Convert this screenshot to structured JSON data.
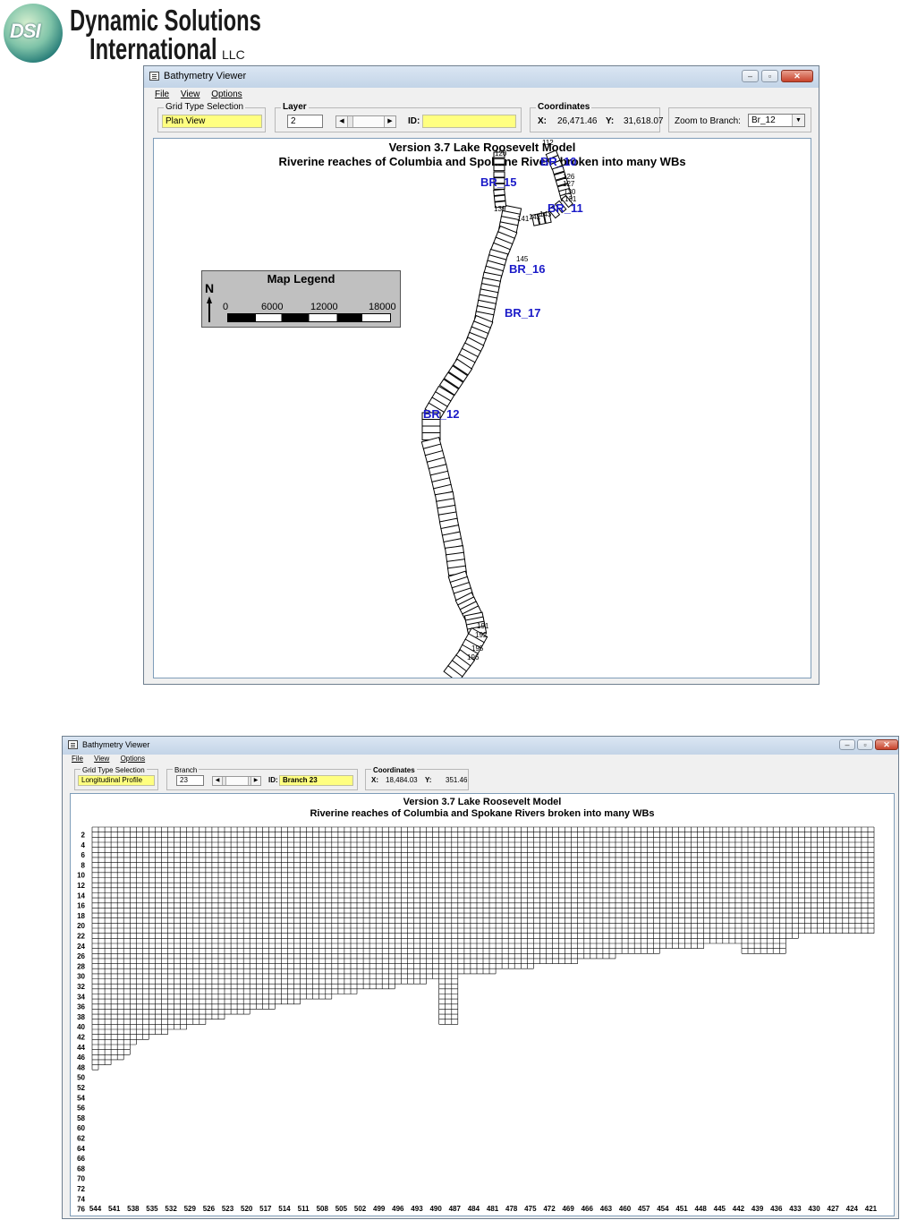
{
  "logo": {
    "mark": "DSI",
    "line1": "Dynamic Solutions",
    "line2": "International",
    "suffix": "LLC"
  },
  "window_top": {
    "title": "Bathymetry Viewer",
    "menu": [
      "File",
      "View",
      "Options"
    ],
    "grid_type": {
      "label": "Grid Type Selection",
      "value": "Plan View"
    },
    "layer": {
      "label": "Layer",
      "value": "2"
    },
    "id": {
      "label": "ID:",
      "value": ""
    },
    "coordinates": {
      "label": "Coordinates",
      "x_label": "X:",
      "x_value": "26,471.46",
      "y_label": "Y:",
      "y_value": "31,618.07"
    },
    "zoom": {
      "label": "Zoom to Branch:",
      "value": "Br_12"
    },
    "plot_title": "Version 3.7 Lake Roosevelt Model",
    "plot_subtitle": "Riverine reaches of Columbia and Spokane Rivers broken into many WBs",
    "legend": {
      "title": "Map Legend",
      "north": "N",
      "scale_labels": [
        "0",
        "6000",
        "12000",
        "18000"
      ]
    },
    "branch_labels": [
      "BR_15",
      "BR_10",
      "BR_11",
      "BR_16",
      "BR_17",
      "BR_12"
    ],
    "segment_labels": [
      "120",
      "112",
      "126",
      "127",
      "130",
      "131",
      "139",
      "141",
      "142",
      "143",
      "145",
      "191",
      "192",
      "195",
      "196"
    ]
  },
  "window_bottom": {
    "title": "Bathymetry Viewer",
    "menu": [
      "File",
      "View",
      "Options"
    ],
    "grid_type": {
      "label": "Grid Type Selection",
      "value": "Longitudinal Profile"
    },
    "branch": {
      "label": "Branch",
      "value": "23"
    },
    "id": {
      "label": "ID:",
      "value": "Branch  23"
    },
    "coordinates": {
      "label": "Coordinates",
      "x_label": "X:",
      "x_value": "18,484.03",
      "y_label": "Y:",
      "y_value": "351.46"
    },
    "plot_title": "Version 3.7 Lake Roosevelt Model",
    "plot_subtitle": "Riverine reaches of Columbia and Spokane Rivers broken into many WBs",
    "y_labels": [
      "2",
      "4",
      "6",
      "8",
      "10",
      "12",
      "14",
      "16",
      "18",
      "20",
      "22",
      "24",
      "26",
      "28",
      "30",
      "32",
      "34",
      "36",
      "38",
      "40",
      "42",
      "44",
      "46",
      "48",
      "50",
      "52",
      "54",
      "56",
      "58",
      "60",
      "62",
      "64",
      "66",
      "68",
      "70",
      "72",
      "74",
      "76"
    ],
    "x_labels": [
      "544",
      "541",
      "538",
      "535",
      "532",
      "529",
      "526",
      "523",
      "520",
      "517",
      "514",
      "511",
      "508",
      "505",
      "502",
      "499",
      "496",
      "493",
      "490",
      "487",
      "484",
      "481",
      "478",
      "475",
      "472",
      "469",
      "466",
      "463",
      "460",
      "457",
      "454",
      "451",
      "448",
      "445",
      "442",
      "439",
      "436",
      "433",
      "430",
      "427",
      "424",
      "421"
    ]
  }
}
